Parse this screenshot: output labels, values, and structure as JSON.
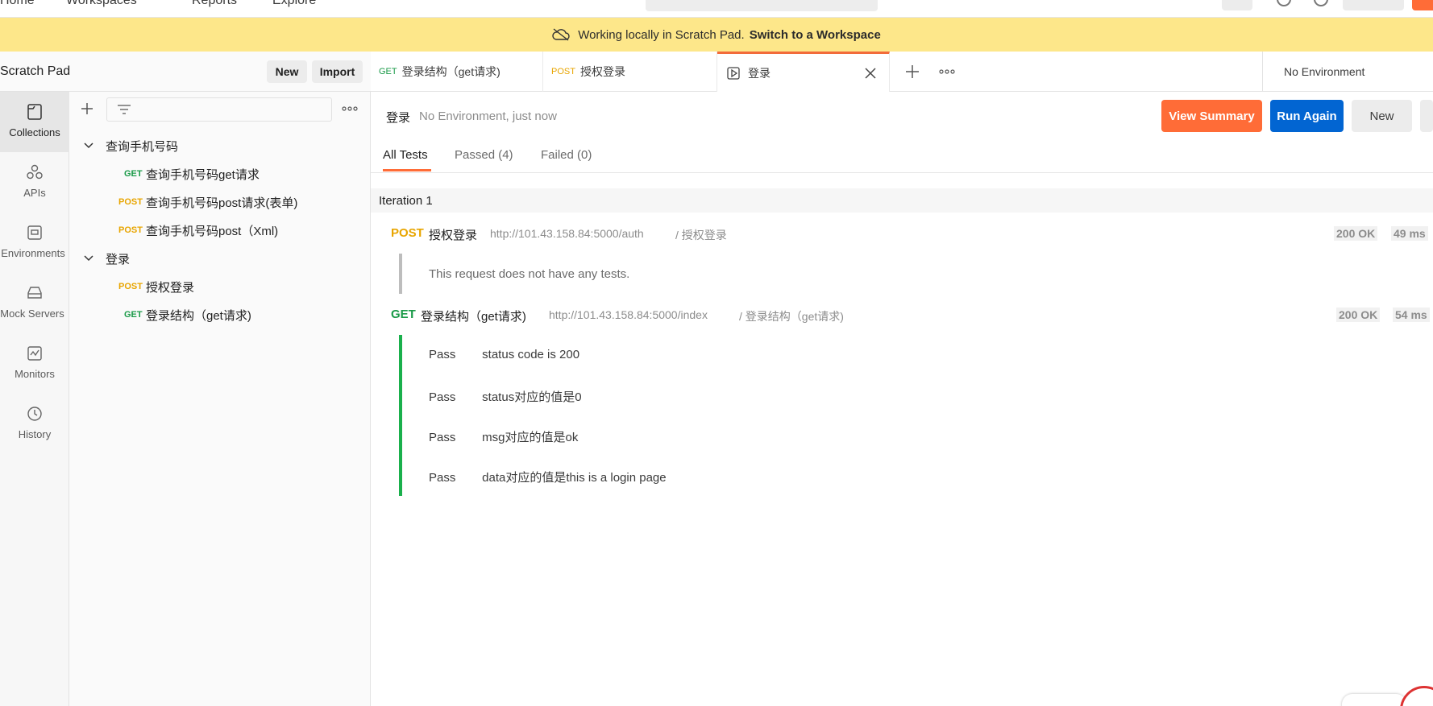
{
  "topnav": {
    "home": "Home",
    "workspaces": "Workspaces",
    "reports": "Reports",
    "explore": "Explore"
  },
  "banner": {
    "text": "Working locally in Scratch Pad.",
    "link": "Switch to a Workspace"
  },
  "rail": [
    {
      "label": "Collections",
      "icon": "collections-icon"
    },
    {
      "label": "APIs",
      "icon": "apis-icon"
    },
    {
      "label": "Environments",
      "icon": "environments-icon"
    },
    {
      "label": "Mock Servers",
      "icon": "mock-servers-icon"
    },
    {
      "label": "Monitors",
      "icon": "monitors-icon"
    },
    {
      "label": "History",
      "icon": "history-icon"
    }
  ],
  "sidebar": {
    "title": "Scratch Pad",
    "new_label": "New",
    "import_label": "Import",
    "tree": [
      {
        "type": "folder",
        "name": "查询手机号码"
      },
      {
        "type": "request",
        "method": "GET",
        "name": "查询手机号码get请求"
      },
      {
        "type": "request",
        "method": "POST",
        "name": "查询手机号码post请求(表单)"
      },
      {
        "type": "request",
        "method": "POST",
        "name": "查询手机号码post（Xml)"
      },
      {
        "type": "folder",
        "name": "登录"
      },
      {
        "type": "request",
        "method": "POST",
        "name": "授权登录"
      },
      {
        "type": "request",
        "method": "GET",
        "name": "登录结构（get请求)"
      }
    ]
  },
  "tabs": [
    {
      "method": "GET",
      "label": "登录结构（get请求)"
    },
    {
      "method": "POST",
      "label": "授权登录"
    },
    {
      "method": "",
      "label": "登录"
    }
  ],
  "environment": "No Environment",
  "runner": {
    "title": "登录",
    "subtitle": "No Environment, just now",
    "view_summary": "View Summary",
    "run_again": "Run Again",
    "new_label": "New",
    "tabs": [
      "All Tests",
      "Passed (4)",
      "Failed (0)"
    ],
    "iteration": "Iteration 1",
    "requests": [
      {
        "method": "POST",
        "name": "授权登录",
        "url": "http://101.43.158.84:5000/auth",
        "path": "/ 授权登录",
        "status": "200 OK",
        "time": "49 ms",
        "note": "This request does not have any tests.",
        "tests": []
      },
      {
        "method": "GET",
        "name": "登录结构（get请求)",
        "url": "http://101.43.158.84:5000/index",
        "path": "/ 登录结构（get请求)",
        "status": "200 OK",
        "time": "54 ms",
        "tests": [
          {
            "result": "Pass",
            "name": "status code is 200"
          },
          {
            "result": "Pass",
            "name": "status对应的值是0"
          },
          {
            "result": "Pass",
            "name": "msg对应的值是ok"
          },
          {
            "result": "Pass",
            "name": "data对应的值是this is a login page"
          }
        ]
      }
    ]
  },
  "colors": {
    "accent": "#ff6c37",
    "primary": "#0265d2",
    "pass": "#1ab04c",
    "banner": "#fde78a",
    "get": "#1a9a48",
    "post": "#e8a500"
  }
}
